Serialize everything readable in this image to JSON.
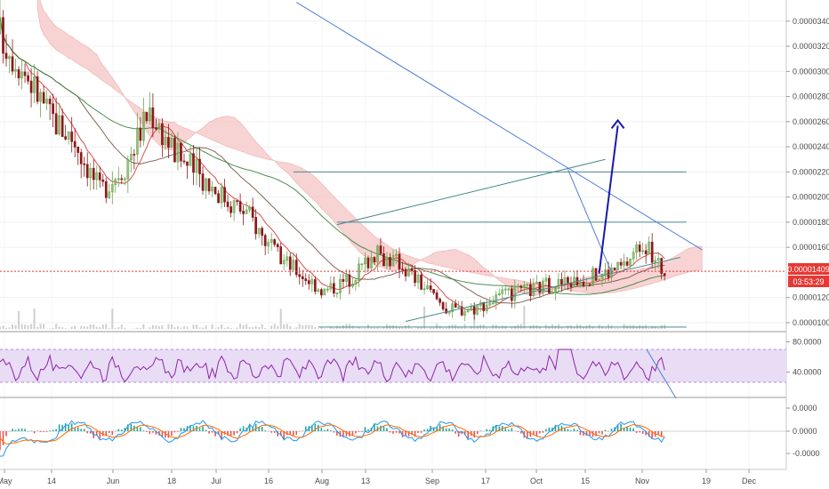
{
  "chart_data": [
    {
      "type": "candlestick",
      "panel": "price",
      "x_ticks": [
        "May",
        "14",
        "Jun",
        "18",
        "Jul",
        "16",
        "Aug",
        "13",
        "Sep",
        "17",
        "Oct",
        "15",
        "Nov",
        "19",
        "Dec"
      ],
      "y_ticks": [
        "0.00003400",
        "0.00003200",
        "0.00003000",
        "0.00002800",
        "0.00002600",
        "0.00002400",
        "0.00002200",
        "0.00002000",
        "0.00001800",
        "0.00001600",
        "0.00001200",
        "0.00001000"
      ],
      "ylim": [
        9.5e-06,
        3.54e-05
      ],
      "last_price": {
        "value": 1.409e-05,
        "label": "0.00001409",
        "countdown": "03:53:29",
        "color": "#e53935"
      },
      "close_path": [
        [
          0,
          3.3e-05
        ],
        [
          8,
          3e-05
        ],
        [
          16,
          2.65e-05
        ],
        [
          24,
          2.45e-05
        ],
        [
          32,
          2.05e-05
        ],
        [
          40,
          2.25e-05
        ],
        [
          48,
          2.7e-05
        ],
        [
          56,
          2.35e-05
        ],
        [
          64,
          2.18e-05
        ],
        [
          72,
          2e-05
        ],
        [
          80,
          1.85e-05
        ],
        [
          88,
          1.55e-05
        ],
        [
          96,
          1.4e-05
        ],
        [
          104,
          1.25e-05
        ],
        [
          112,
          1.35e-05
        ],
        [
          120,
          1.55e-05
        ],
        [
          128,
          1.48e-05
        ],
        [
          136,
          1.28e-05
        ],
        [
          144,
          1.1e-05
        ],
        [
          152,
          1.12e-05
        ],
        [
          160,
          1.2e-05
        ],
        [
          168,
          1.25e-05
        ],
        [
          176,
          1.3e-05
        ],
        [
          184,
          1.33e-05
        ],
        [
          192,
          1.38e-05
        ],
        [
          200,
          1.45e-05
        ],
        [
          206,
          1.65e-05
        ],
        [
          210,
          1.48e-05
        ],
        [
          213,
          1.41e-05
        ]
      ],
      "trend_lines": [
        {
          "x": [
            94,
            220
          ],
          "y": [
            2.2e-05,
            2.2e-05
          ],
          "color": "#4a8a8f"
        },
        {
          "x": [
            108,
            220
          ],
          "y": [
            1.8e-05,
            1.8e-05
          ],
          "color": "#4a8a8f"
        },
        {
          "x": [
            102,
            220
          ],
          "y": [
            9.65e-06,
            9.65e-06
          ],
          "color": "#4a8a8f"
        },
        {
          "x": [
            130,
            218
          ],
          "y": [
            1.01e-05,
            1.52e-05
          ],
          "color": "#4a8a8f"
        },
        {
          "x": [
            108,
            194
          ],
          "y": [
            1.78e-05,
            2.3e-05
          ],
          "color": "#4a8a8f"
        },
        {
          "x": [
            95,
            225
          ],
          "y": [
            3.55e-05,
            1.58e-05
          ],
          "color": "#4f7fd6"
        },
        {
          "x": [
            182,
            196
          ],
          "y": [
            2.22e-05,
            1.4e-05
          ],
          "color": "#4f7fd6"
        }
      ],
      "projection_arrow": {
        "x": [
          192,
          198
        ],
        "y": [
          1.39e-05,
          2.61e-05
        ],
        "color": "#1a1aa8"
      }
    },
    {
      "type": "line",
      "panel": "rsi",
      "y_ticks": [
        "80.0000",
        "40.0000"
      ],
      "ylim": [
        10,
        90
      ],
      "band": [
        30,
        70
      ],
      "color": "#8e24aa"
    },
    {
      "type": "line",
      "panel": "macd",
      "y_ticks": [
        "0.0000",
        "0.0000",
        "-0.0000"
      ],
      "ylim": [
        -1,
        1
      ]
    }
  ]
}
